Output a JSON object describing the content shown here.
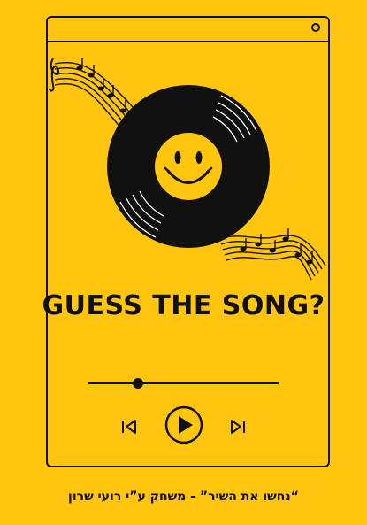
{
  "app": {
    "title": "GUESS THE SONG?",
    "footer": "“נחשו את השיר” - משחק ע”י רועי שרון"
  },
  "player": {
    "progress": 0.26
  },
  "icons": {
    "prev": "skip-previous-icon",
    "play": "play-icon",
    "next": "skip-next-icon",
    "record": "vinyl-record-smiley-icon",
    "notes": "music-notes-icon"
  },
  "colors": {
    "background": "#FFC50F",
    "ink": "#111111",
    "accent": "#FFC50F"
  }
}
